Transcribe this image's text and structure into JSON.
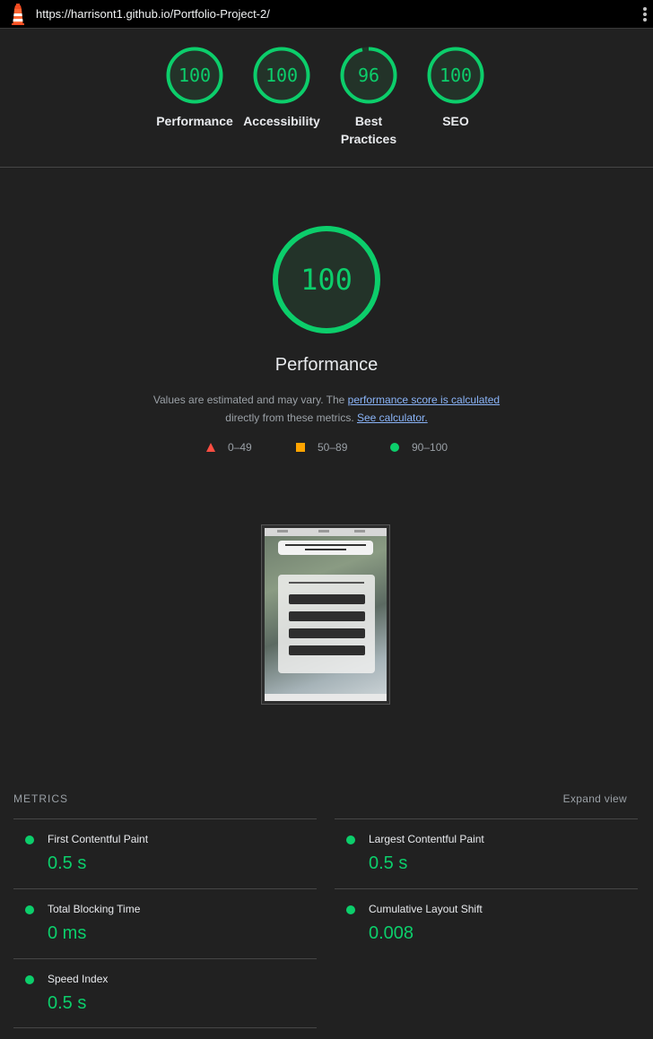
{
  "browser": {
    "url": "https://harrisont1.github.io/Portfolio-Project-2/"
  },
  "gauges": [
    {
      "label": "Performance",
      "score": 100
    },
    {
      "label": "Accessibility",
      "score": 100
    },
    {
      "label": "Best Practices",
      "score": 96
    },
    {
      "label": "SEO",
      "score": 100
    }
  ],
  "performance": {
    "score": 100,
    "title": "Performance",
    "desc_prefix": "Values are estimated and may vary. The ",
    "desc_link1": "performance score is calculated",
    "desc_middle": " directly from these metrics. ",
    "desc_link2": "See calculator.",
    "legend": {
      "fail": "0–49",
      "average": "50–89",
      "pass": "90–100"
    }
  },
  "metrics": {
    "heading": "METRICS",
    "expand_label": "Expand view",
    "items": [
      {
        "title": "First Contentful Paint",
        "value": "0.5 s"
      },
      {
        "title": "Largest Contentful Paint",
        "value": "0.5 s"
      },
      {
        "title": "Total Blocking Time",
        "value": "0 ms"
      },
      {
        "title": "Cumulative Layout Shift",
        "value": "0.008"
      },
      {
        "title": "Speed Index",
        "value": "0.5 s"
      }
    ]
  },
  "colors": {
    "pass": "#0cce6b",
    "average": "#ffa400",
    "fail": "#ff4e42",
    "link": "#8ab4f8"
  }
}
